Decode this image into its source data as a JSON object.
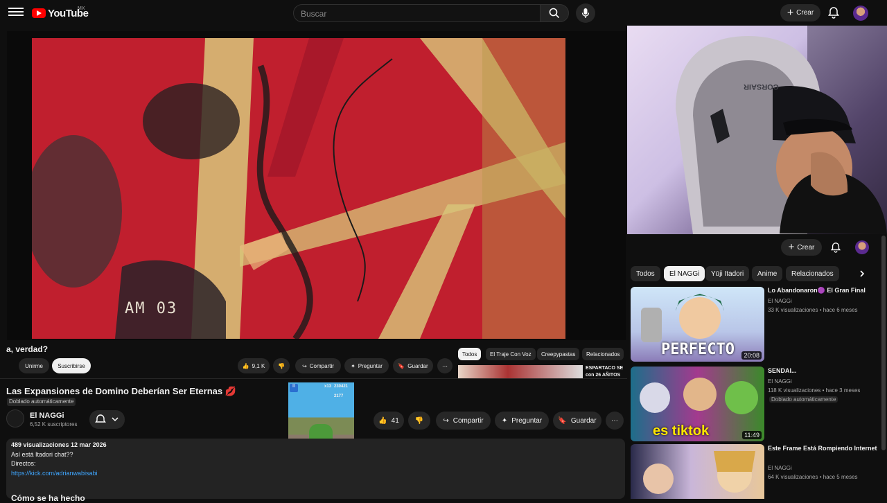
{
  "header": {
    "logo_text": "YouTube",
    "logo_country": "MX",
    "search_placeholder": "Buscar",
    "create_label": "Crear"
  },
  "miniplayer": {
    "title_fragment": "a, verdad?",
    "join_label": "Unirme",
    "subscribe_label": "Suscribirse",
    "likes": "9,1 K",
    "share_label": "Compartir",
    "ask_label": "Preguntar",
    "save_label": "Guardar",
    "chips": [
      "Todos",
      "El Traje Con Voz",
      "Creepypastas",
      "Relacionados"
    ],
    "rec_title": "ESPARTACO SE con 26 AÑITOS",
    "video_stamp": "AM 03"
  },
  "video": {
    "title": "Las Expansiones de Domino Deberían Ser Eternas",
    "dub_badge": "Doblado automáticamente",
    "channel_name": "El NAGGi",
    "subscribers": "6,52 K suscriptores",
    "likes": "41",
    "share_label": "Compartir",
    "ask_label": "Preguntar",
    "save_label": "Guardar",
    "game_score_a": "x13",
    "game_score_b": "230421",
    "game_coins": "2177"
  },
  "description": {
    "stats": "489 visualizaciones  12 mar 2026",
    "line1": "Así está Itadori chat??",
    "line2": "Directos:",
    "link": "https://kick.com/adrianwabisabi",
    "heading": "Cómo se ha hecho"
  },
  "right": {
    "create_label": "Crear",
    "chair_brand": "CORSAIR",
    "tabs": [
      "Todos",
      "El NAGGi",
      "Yūji Itadori",
      "Anime",
      "Relacionados"
    ],
    "active_tab": 1,
    "recs": [
      {
        "title": "Lo Abandonaron🟣 El Gran Final",
        "channel": "El NAGGi",
        "meta": "33 K visualizaciones • hace 6 meses",
        "badge": "",
        "duration": "20:08",
        "overlay": "PERFECTO"
      },
      {
        "title": "SENDAI...",
        "channel": "El NAGGi",
        "meta": "118 K visualizaciones • hace 3 meses",
        "badge": "Doblado automáticamente",
        "duration": "11:49",
        "overlay": "es tiktok"
      },
      {
        "title": "Este Frame Está Rompiendo Internet",
        "channel": "El NAGGi",
        "meta": "64 K visualizaciones • hace 5 meses",
        "badge": "",
        "duration": "",
        "overlay": ""
      }
    ]
  },
  "colors": {
    "background": "#0f0f0f",
    "brand_red": "#ff0000",
    "link": "#3ea6ff",
    "chip": "#272727"
  }
}
